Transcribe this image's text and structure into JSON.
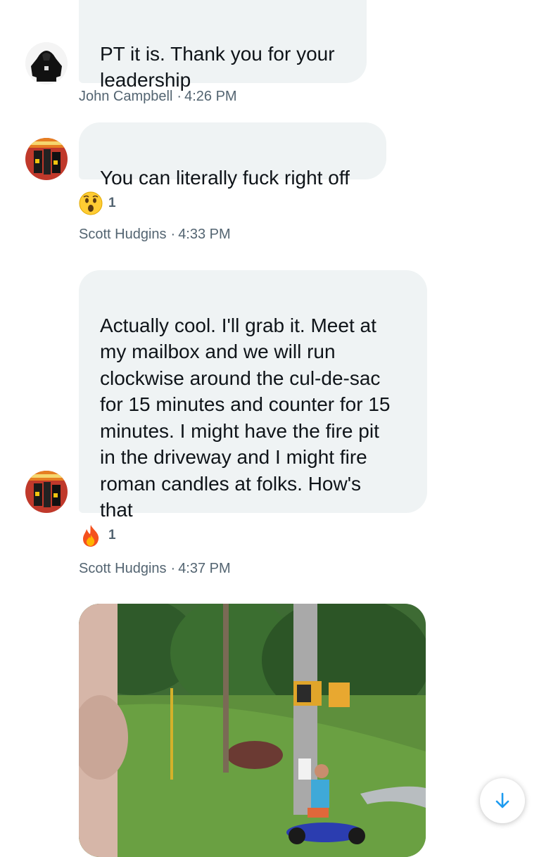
{
  "messages": [
    {
      "text": "PT it is. Thank you for your\nleadership",
      "author": "John Campbell",
      "time": "4:26 PM",
      "avatar_icon": "hoodie-avatar-icon"
    },
    {
      "text": "You can literally fuck right off",
      "author": "Scott Hudgins",
      "time": "4:33 PM",
      "avatar_icon": "poster-avatar-icon",
      "reaction": {
        "emoji": "astonished-face-icon",
        "count": "1"
      }
    },
    {
      "text": "Actually cool. I'll grab it. Meet at\nmy mailbox and we will run\nclockwise around the cul-de-sac\nfor 15 minutes and counter for 15\nminutes. I might have the fire pit\nin the driveway and I might fire\nroman candles at folks. How's\nthat",
      "author": "Scott Hudgins",
      "time": "4:37 PM",
      "avatar_icon": "poster-avatar-icon",
      "reaction": {
        "emoji": "fire-icon",
        "count": "1"
      }
    }
  ],
  "separator": "·",
  "media": {
    "icon": "photo-attachment"
  },
  "scroll_button": {
    "icon": "arrow-down-icon"
  },
  "colors": {
    "bubble_bg": "#eff3f4",
    "meta_text": "#536471",
    "accent": "#1d9bf0"
  }
}
